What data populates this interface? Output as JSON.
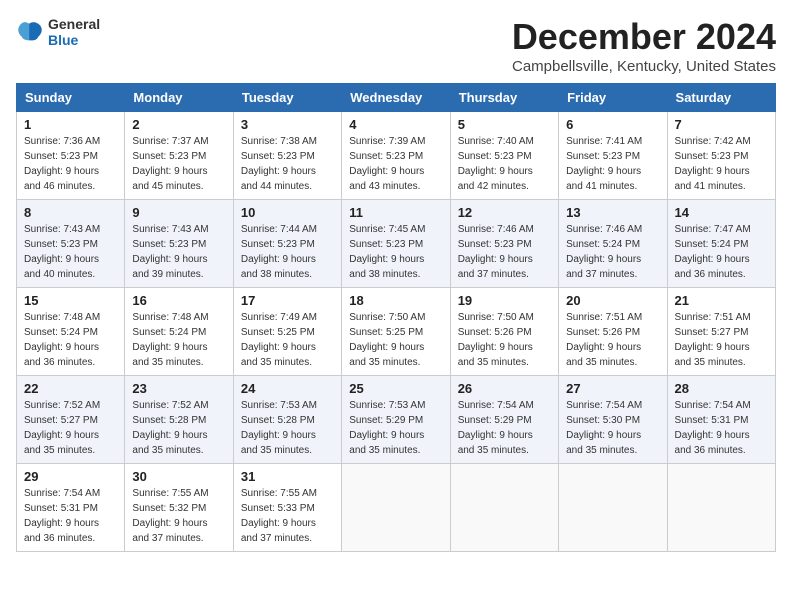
{
  "header": {
    "logo_general": "General",
    "logo_blue": "Blue",
    "title": "December 2024",
    "location": "Campbellsville, Kentucky, United States"
  },
  "calendar": {
    "days_of_week": [
      "Sunday",
      "Monday",
      "Tuesday",
      "Wednesday",
      "Thursday",
      "Friday",
      "Saturday"
    ],
    "weeks": [
      [
        {
          "day": "",
          "details": ""
        },
        {
          "day": "2",
          "details": "Sunrise: 7:37 AM\nSunset: 5:23 PM\nDaylight: 9 hours and 45 minutes."
        },
        {
          "day": "3",
          "details": "Sunrise: 7:38 AM\nSunset: 5:23 PM\nDaylight: 9 hours and 44 minutes."
        },
        {
          "day": "4",
          "details": "Sunrise: 7:39 AM\nSunset: 5:23 PM\nDaylight: 9 hours and 43 minutes."
        },
        {
          "day": "5",
          "details": "Sunrise: 7:40 AM\nSunset: 5:23 PM\nDaylight: 9 hours and 42 minutes."
        },
        {
          "day": "6",
          "details": "Sunrise: 7:41 AM\nSunset: 5:23 PM\nDaylight: 9 hours and 41 minutes."
        },
        {
          "day": "7",
          "details": "Sunrise: 7:42 AM\nSunset: 5:23 PM\nDaylight: 9 hours and 41 minutes."
        }
      ],
      [
        {
          "day": "1",
          "details": "Sunrise: 7:36 AM\nSunset: 5:23 PM\nDaylight: 9 hours and 46 minutes."
        },
        null,
        null,
        null,
        null,
        null,
        null
      ],
      [
        {
          "day": "8",
          "details": "Sunrise: 7:43 AM\nSunset: 5:23 PM\nDaylight: 9 hours and 40 minutes."
        },
        {
          "day": "9",
          "details": "Sunrise: 7:43 AM\nSunset: 5:23 PM\nDaylight: 9 hours and 39 minutes."
        },
        {
          "day": "10",
          "details": "Sunrise: 7:44 AM\nSunset: 5:23 PM\nDaylight: 9 hours and 38 minutes."
        },
        {
          "day": "11",
          "details": "Sunrise: 7:45 AM\nSunset: 5:23 PM\nDaylight: 9 hours and 38 minutes."
        },
        {
          "day": "12",
          "details": "Sunrise: 7:46 AM\nSunset: 5:23 PM\nDaylight: 9 hours and 37 minutes."
        },
        {
          "day": "13",
          "details": "Sunrise: 7:46 AM\nSunset: 5:24 PM\nDaylight: 9 hours and 37 minutes."
        },
        {
          "day": "14",
          "details": "Sunrise: 7:47 AM\nSunset: 5:24 PM\nDaylight: 9 hours and 36 minutes."
        }
      ],
      [
        {
          "day": "15",
          "details": "Sunrise: 7:48 AM\nSunset: 5:24 PM\nDaylight: 9 hours and 36 minutes."
        },
        {
          "day": "16",
          "details": "Sunrise: 7:48 AM\nSunset: 5:24 PM\nDaylight: 9 hours and 35 minutes."
        },
        {
          "day": "17",
          "details": "Sunrise: 7:49 AM\nSunset: 5:25 PM\nDaylight: 9 hours and 35 minutes."
        },
        {
          "day": "18",
          "details": "Sunrise: 7:50 AM\nSunset: 5:25 PM\nDaylight: 9 hours and 35 minutes."
        },
        {
          "day": "19",
          "details": "Sunrise: 7:50 AM\nSunset: 5:26 PM\nDaylight: 9 hours and 35 minutes."
        },
        {
          "day": "20",
          "details": "Sunrise: 7:51 AM\nSunset: 5:26 PM\nDaylight: 9 hours and 35 minutes."
        },
        {
          "day": "21",
          "details": "Sunrise: 7:51 AM\nSunset: 5:27 PM\nDaylight: 9 hours and 35 minutes."
        }
      ],
      [
        {
          "day": "22",
          "details": "Sunrise: 7:52 AM\nSunset: 5:27 PM\nDaylight: 9 hours and 35 minutes."
        },
        {
          "day": "23",
          "details": "Sunrise: 7:52 AM\nSunset: 5:28 PM\nDaylight: 9 hours and 35 minutes."
        },
        {
          "day": "24",
          "details": "Sunrise: 7:53 AM\nSunset: 5:28 PM\nDaylight: 9 hours and 35 minutes."
        },
        {
          "day": "25",
          "details": "Sunrise: 7:53 AM\nSunset: 5:29 PM\nDaylight: 9 hours and 35 minutes."
        },
        {
          "day": "26",
          "details": "Sunrise: 7:54 AM\nSunset: 5:29 PM\nDaylight: 9 hours and 35 minutes."
        },
        {
          "day": "27",
          "details": "Sunrise: 7:54 AM\nSunset: 5:30 PM\nDaylight: 9 hours and 35 minutes."
        },
        {
          "day": "28",
          "details": "Sunrise: 7:54 AM\nSunset: 5:31 PM\nDaylight: 9 hours and 36 minutes."
        }
      ],
      [
        {
          "day": "29",
          "details": "Sunrise: 7:54 AM\nSunset: 5:31 PM\nDaylight: 9 hours and 36 minutes."
        },
        {
          "day": "30",
          "details": "Sunrise: 7:55 AM\nSunset: 5:32 PM\nDaylight: 9 hours and 37 minutes."
        },
        {
          "day": "31",
          "details": "Sunrise: 7:55 AM\nSunset: 5:33 PM\nDaylight: 9 hours and 37 minutes."
        },
        {
          "day": "",
          "details": ""
        },
        {
          "day": "",
          "details": ""
        },
        {
          "day": "",
          "details": ""
        },
        {
          "day": "",
          "details": ""
        }
      ]
    ]
  }
}
